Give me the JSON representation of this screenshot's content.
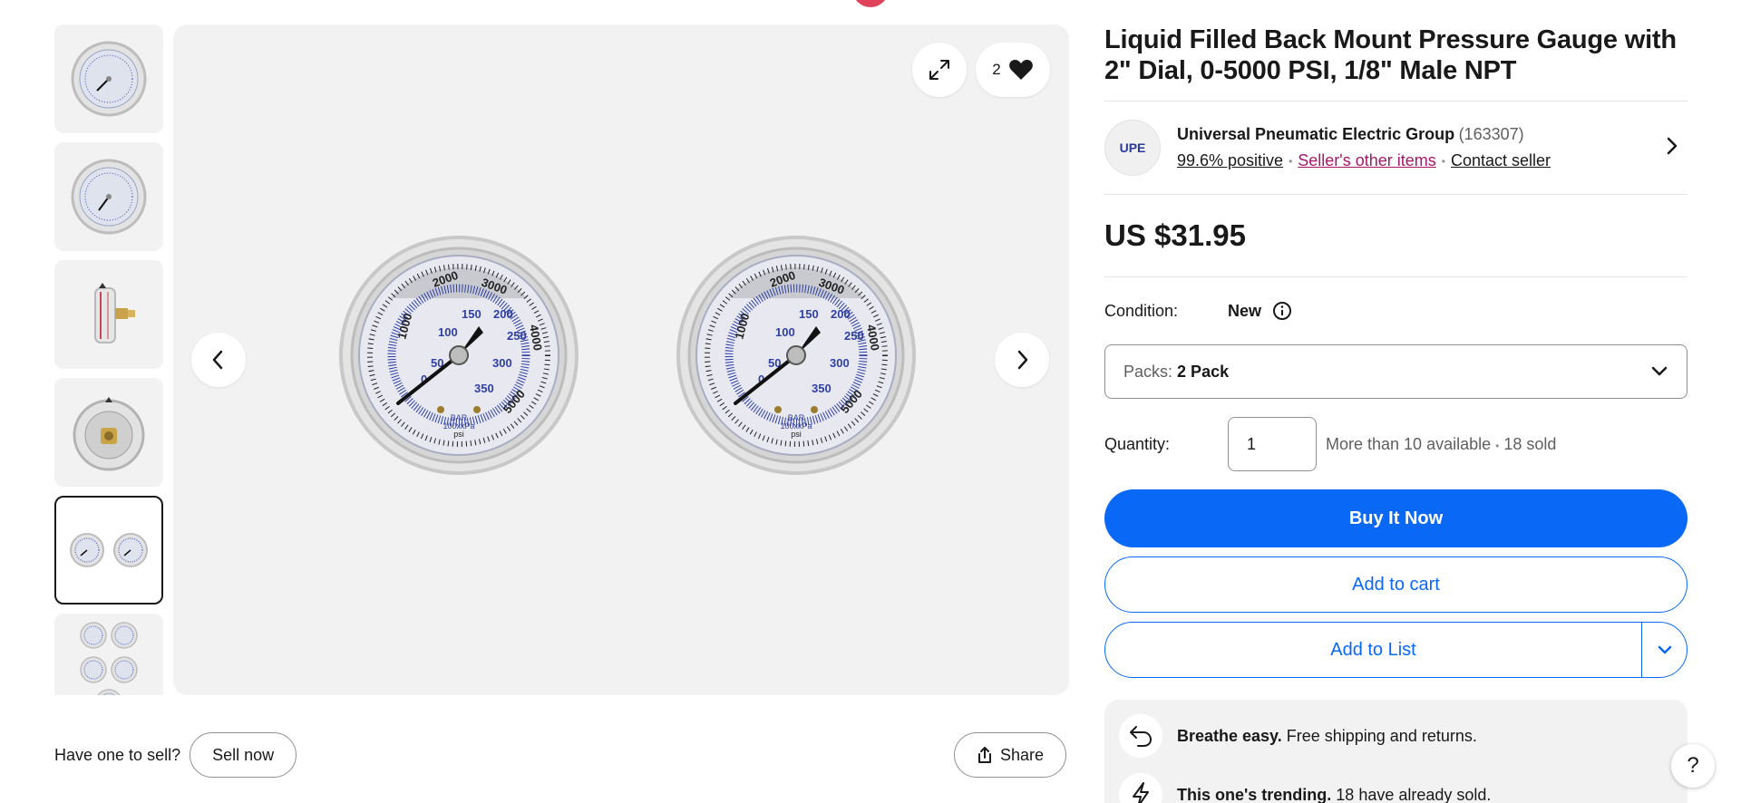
{
  "product": {
    "title": "Liquid Filled Back Mount Pressure Gauge with 2\" Dial, 0-5000 PSI, 1/8\" Male NPT"
  },
  "gallery": {
    "watch_count": "2",
    "gauge_labels": {
      "outer_1": "1000",
      "outer_2": "2000",
      "outer_3": "3000",
      "outer_4": "4000",
      "outer_5": "5000",
      "inner_50": "50",
      "inner_100": "100",
      "inner_150": "150",
      "inner_200": "200",
      "inner_250": "250",
      "inner_300": "300",
      "inner_350": "350",
      "inner_0": "0",
      "unit_bar": "BAR",
      "unit_kpa": "100xkPa",
      "unit_psi": "psi"
    }
  },
  "sell": {
    "prompt": "Have one to sell?",
    "button": "Sell now"
  },
  "share": {
    "label": "Share"
  },
  "seller": {
    "name": "Universal Pneumatic Electric Group",
    "feedback_count": "(163307)",
    "positive": "99.6% positive",
    "other_items": "Seller's other items",
    "contact": "Contact seller",
    "logo_text": "UPE"
  },
  "price": {
    "display": "US $31.95"
  },
  "condition": {
    "label": "Condition:",
    "value": "New"
  },
  "variation": {
    "label": "Packs:",
    "selected": "2 Pack"
  },
  "quantity": {
    "label": "Quantity:",
    "value": "1",
    "availability": "More than 10 available",
    "sold": "18 sold"
  },
  "actions": {
    "buy_now": "Buy It Now",
    "add_to_cart": "Add to cart",
    "add_to_list": "Add to List"
  },
  "promos": [
    {
      "bold": "Breathe easy.",
      "text": " Free shipping and returns.",
      "icon": "return-arrow-icon"
    },
    {
      "bold": "This one's trending.",
      "text": " 18 have already sold.",
      "icon": "lightning-icon"
    }
  ],
  "help": {
    "label": "?"
  },
  "colors": {
    "primary_blue": "#0968f6",
    "seller_link_pink": "#a5166e",
    "panel_gray": "#f2f2f2"
  }
}
